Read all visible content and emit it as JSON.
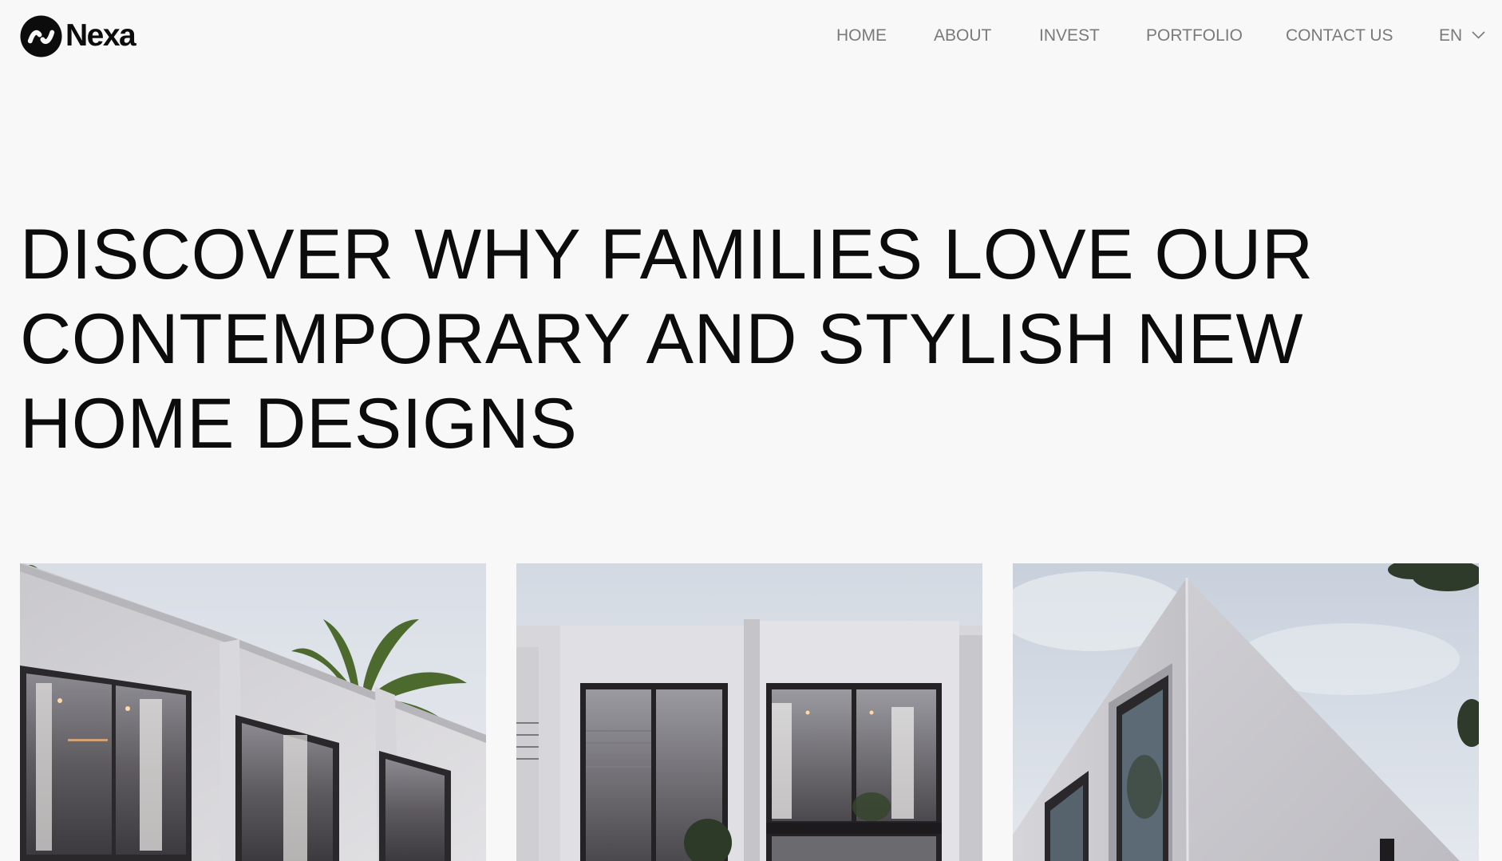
{
  "brand": {
    "name": "Nexa",
    "logo_icon": "nexa-logo-icon"
  },
  "nav": {
    "items": [
      {
        "label": "HOME"
      },
      {
        "label": "ABOUT"
      },
      {
        "label": "INVEST"
      },
      {
        "label": "PORTFOLIO"
      },
      {
        "label": "CONTACT US"
      }
    ],
    "language": {
      "label": "EN",
      "icon": "chevron-down-icon"
    }
  },
  "hero": {
    "title_lines": [
      "DISCOVER WHY FAMILIES LOVE OUR",
      "CONTEMPORARY AND STYLISH NEW",
      "HOME DESIGNS"
    ]
  },
  "gallery": {
    "images": [
      {
        "subject": "modern-townhouse-facade-with-palm"
      },
      {
        "subject": "modern-townhouse-double-frame"
      },
      {
        "subject": "modern-house-corner-sky"
      }
    ]
  },
  "colors": {
    "background": "#f8f8f8",
    "text": "#0c0c0c",
    "nav_text": "#7a7a7a"
  }
}
